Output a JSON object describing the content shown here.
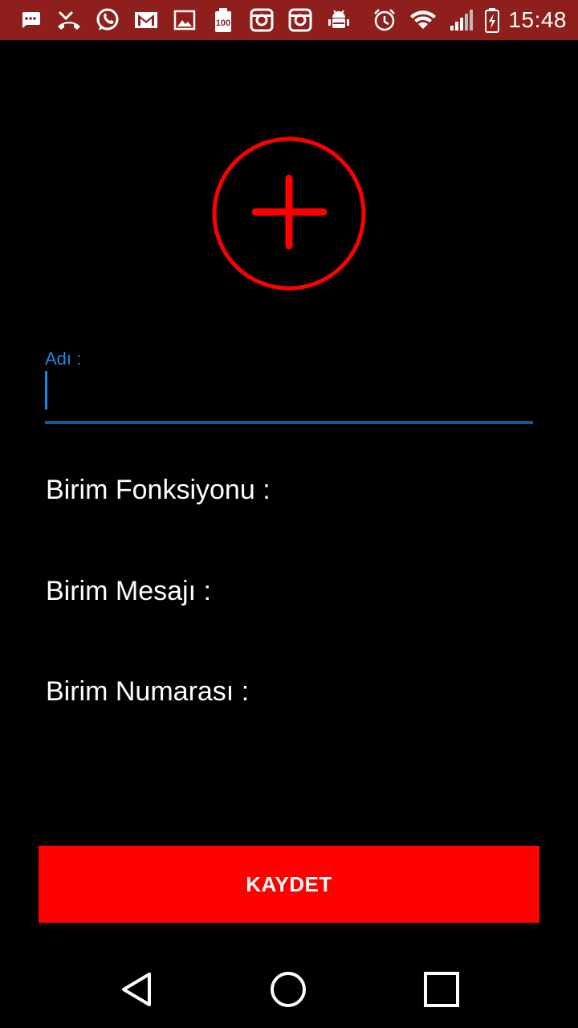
{
  "status_bar": {
    "background_color": "#8e1f1c",
    "left_icons": [
      "messages-icon",
      "missed-call-icon",
      "whatsapp-icon",
      "gmail-icon",
      "gallery-icon",
      "battery-100-badge-icon",
      "instagram-icon",
      "instagram-icon",
      "android-debug-icon"
    ],
    "badge_text": "100",
    "right_icons": [
      "alarm-icon",
      "wifi-icon",
      "signal-icon",
      "battery-charging-icon"
    ],
    "time": "15:48"
  },
  "add_button": {
    "icon": "add-circle-icon",
    "color": "#ff0000"
  },
  "form": {
    "name_label": "Adı :",
    "name_value": "",
    "accent_color": "#1e88e5",
    "unit_function_label": "Birim Fonksiyonu :",
    "unit_message_label": "Birim Mesajı :",
    "unit_number_label": "Birim Numarası :"
  },
  "save_button": {
    "label": "KAYDET",
    "color": "#ff0000"
  },
  "nav_bar": {
    "buttons": [
      "back-icon",
      "home-icon",
      "recents-icon"
    ]
  }
}
